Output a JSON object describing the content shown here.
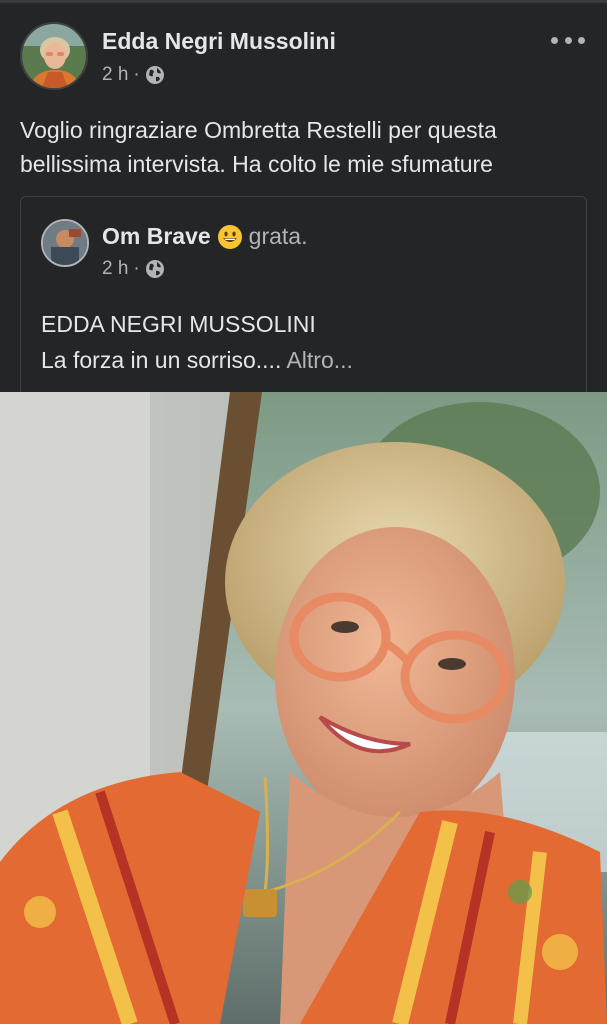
{
  "post": {
    "author": "Edda Negri Mussolini",
    "time": "2 h",
    "separator": "·",
    "privacy_icon": "globe-icon",
    "menu_icon": "more-dots-icon",
    "text": "Voglio ringraziare Ombretta Restelli per questa bellissima intervista. Ha colto le mie sfumature"
  },
  "shared_post": {
    "author": "Om Brave",
    "feeling_emoji": "grinning-face-emoji",
    "feeling_text": "grata.",
    "time": "2 h",
    "separator": "·",
    "privacy_icon": "globe-icon",
    "line1": "EDDA NEGRI MUSSOLINI",
    "line2": "La forza in un sorriso....",
    "see_more": "Altro..."
  },
  "colors": {
    "background": "#242527",
    "text_primary": "#e4e6eb",
    "text_secondary": "#b0b3b8",
    "border": "#3e4042"
  }
}
